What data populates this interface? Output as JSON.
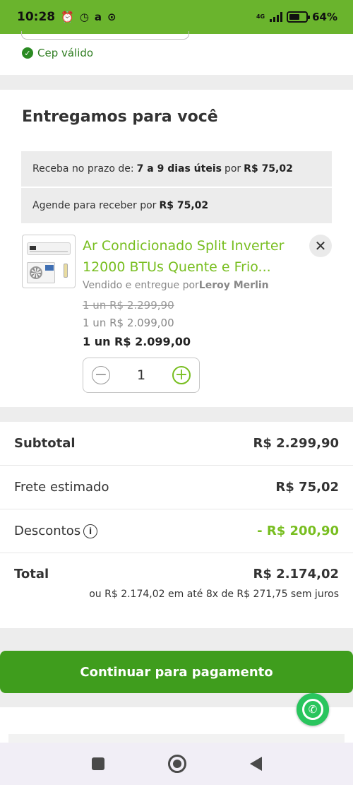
{
  "status_bar": {
    "time": "10:28",
    "network": "4G",
    "battery": "64%",
    "battery_level": 0.64
  },
  "cep": {
    "status_text": "Cep válido"
  },
  "delivery": {
    "title": "Entregamos para você",
    "option_1": {
      "prefix": "Receba no prazo de:",
      "deadline": "7 a 9 dias úteis",
      "por": "por",
      "price": "R$ 75,02"
    },
    "option_2": {
      "prefix": "Agende para receber por",
      "price": "R$ 75,02"
    }
  },
  "product": {
    "name": "Ar Condicionado Split Inverter 12000 BTUs Quente e Frio...",
    "seller_prefix": "Vendido e entregue por",
    "seller_name": "Leroy Merlin",
    "old_price": "1 un R$ 2.299,90",
    "mid_price": "1 un R$ 2.099,00",
    "current_price": "1 un R$ 2.099,00",
    "quantity": "1"
  },
  "summary": {
    "subtotal_label": "Subtotal",
    "subtotal_value": "R$ 2.299,90",
    "shipping_label": "Frete estimado",
    "shipping_value": "R$ 75,02",
    "discount_label": "Descontos",
    "discount_value": "- R$ 200,90",
    "total_label": "Total",
    "total_value": "R$ 2.174,02",
    "installments": "ou R$ 2.174,02 em até 8x de R$ 271,75 sem juros"
  },
  "cta": {
    "label": "Continuar para pagamento"
  },
  "icons": {
    "check": "check-circle-icon",
    "remove": "close-icon",
    "info": "info-icon",
    "whatsapp": "whatsapp-icon"
  },
  "colors": {
    "status_bar": "#6ab42d",
    "brand_green": "#78be20",
    "cta_green": "#3f9d1d",
    "valid_green": "#2a8a22"
  }
}
